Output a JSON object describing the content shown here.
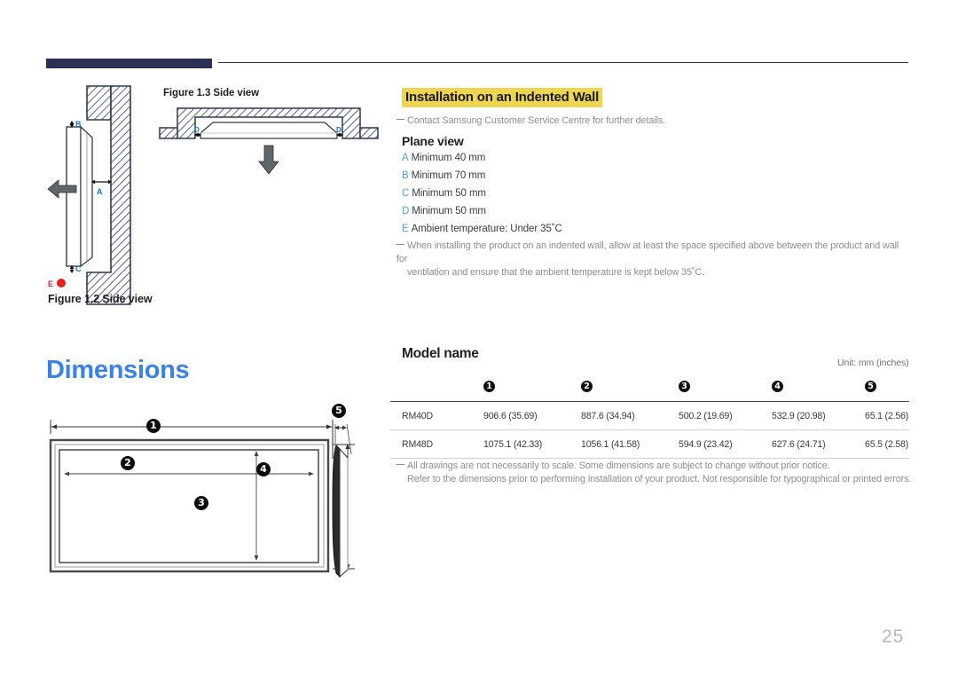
{
  "header": {
    "rule_color": "#2b3055"
  },
  "figures": {
    "fig_1_3_caption": "Figure 1.3 Side view",
    "fig_1_2_caption": "Figure 1.2 Side view",
    "labels": {
      "a": "A",
      "b": "B",
      "c": "C",
      "d": "D",
      "e": "E"
    }
  },
  "section": {
    "title": "Installation on an Indented Wall",
    "title_highlight": "#ecd551",
    "contact_note": "Contact Samsung Customer Service Centre for further details.",
    "subtitle": "Plane view",
    "clearances": [
      {
        "key": "A",
        "text": "Minimum 40 mm"
      },
      {
        "key": "B",
        "text": "Minimum 70 mm"
      },
      {
        "key": "C",
        "text": "Minimum 50 mm"
      },
      {
        "key": "D",
        "text": "Minimum 50 mm"
      },
      {
        "key": "E",
        "text": "Ambient temperature: Under 35˚C"
      }
    ],
    "ventilation_note_line1": "When installing the product on an indented wall, allow at least the space specified above between the product and wall for",
    "ventilation_note_line2": "ventilation and ensure that the ambient temperature is kept below 35˚C."
  },
  "dimensions": {
    "heading": "Dimensions",
    "heading_color": "#3b82e8",
    "callouts": [
      "1",
      "2",
      "3",
      "4",
      "5"
    ],
    "unit_label": "Unit: mm (inches)",
    "model_name_header": "Model name",
    "columns": [
      "Model name",
      "1",
      "2",
      "3",
      "4",
      "5"
    ],
    "rows": [
      {
        "model": "RM40D",
        "values": [
          "906.6 (35.69)",
          "887.6 (34.94)",
          "500.2 (19.69)",
          "532.9 (20.98)",
          "65.1 (2.56)"
        ]
      },
      {
        "model": "RM48D",
        "values": [
          "1075.1 (42.33)",
          "1056.1 (41.58)",
          "594.9 (23.42)",
          "627.6 (24.71)",
          "65.5 (2.58)"
        ]
      }
    ],
    "scale_note_line1": "All drawings are not necessarily to scale. Some dimensions are subject to change without prior notice.",
    "scale_note_line2": "Refer to the dimensions prior to performing installation of your product. Not responsible for typographical or printed errors."
  },
  "footer": {
    "page_number": "25"
  }
}
